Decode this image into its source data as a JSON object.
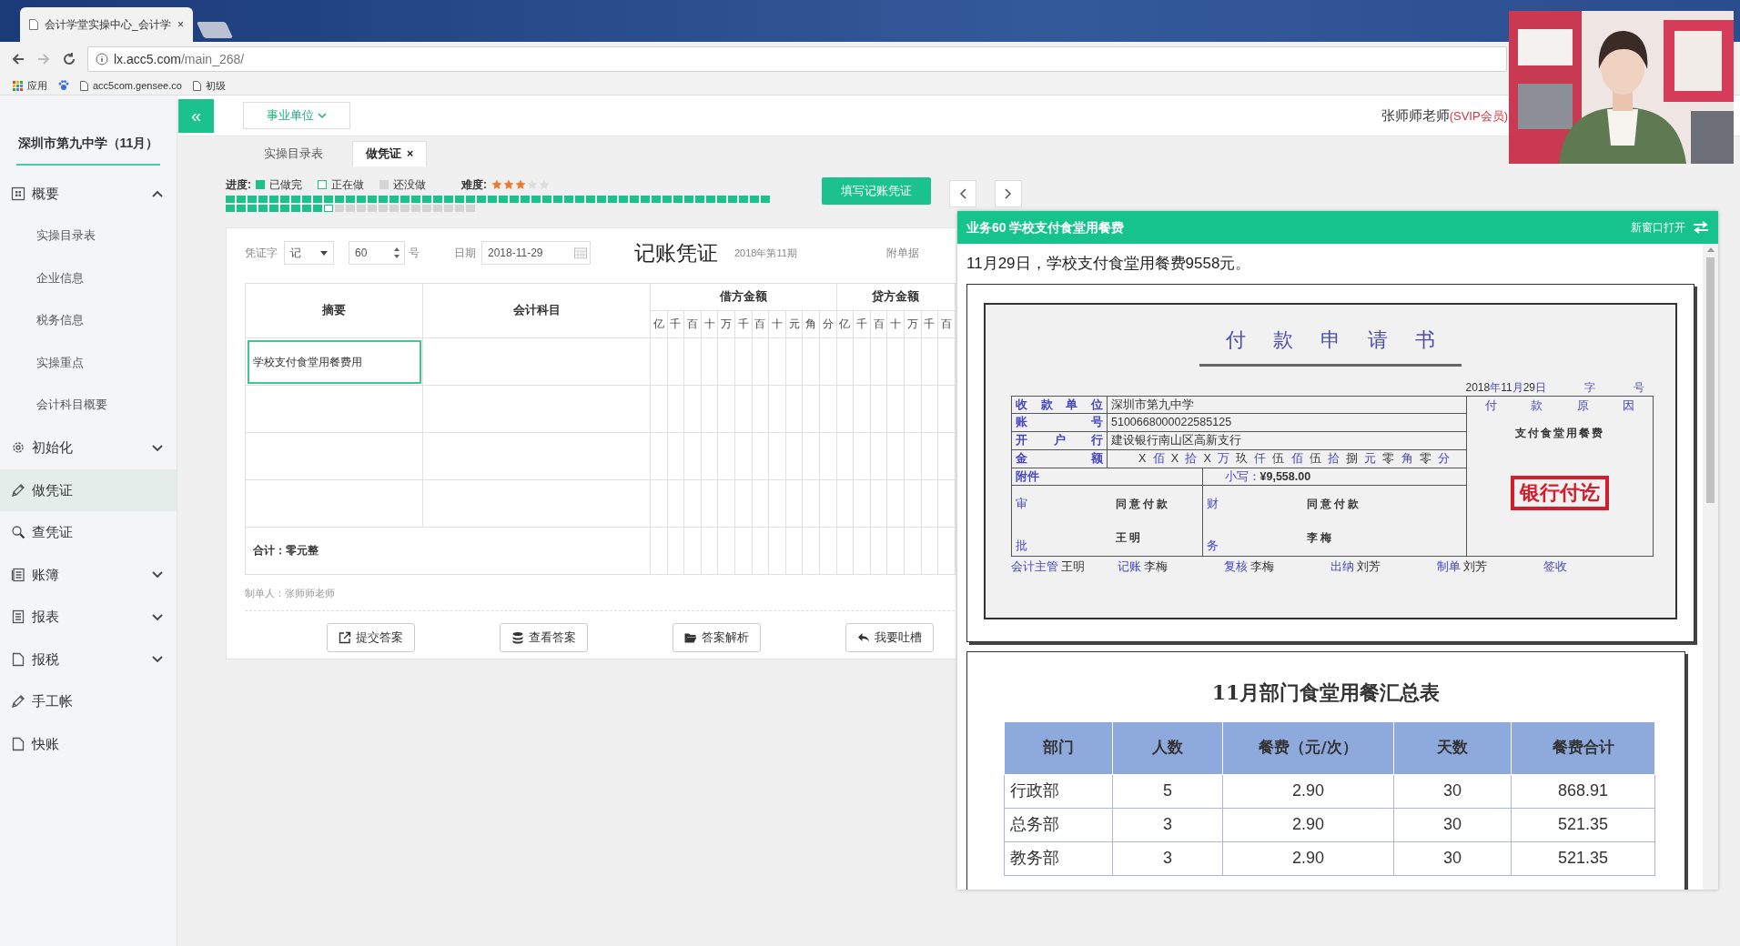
{
  "browser": {
    "tab_title": "会计学堂实操中心_会计学",
    "tab_close": "×",
    "url_host": "lx.acc5.com",
    "url_path": "/main_268/",
    "bookmarks": [
      {
        "kind": "apps",
        "label": "应用"
      },
      {
        "kind": "site"
      },
      {
        "kind": "page",
        "label": "acc5com.gensee.co"
      },
      {
        "kind": "page",
        "label": "初级"
      }
    ]
  },
  "sidebar": {
    "title": "深圳市第九中学（11月）",
    "items": [
      {
        "label": "概要",
        "expanded": true,
        "selected": false,
        "children": [
          {
            "label": "实操目录表",
            "selected": false
          },
          {
            "label": "企业信息",
            "selected": false
          },
          {
            "label": "税务信息",
            "selected": false
          },
          {
            "label": "实操重点",
            "selected": false
          },
          {
            "label": "会计科目概要",
            "selected": false
          }
        ]
      },
      {
        "label": "初始化",
        "expanded": false,
        "selected": false
      },
      {
        "label": "做凭证",
        "selected": true
      },
      {
        "label": "查凭证",
        "selected": false
      },
      {
        "label": "账簿",
        "expanded": false,
        "selected": false
      },
      {
        "label": "报表",
        "expanded": false,
        "selected": false
      },
      {
        "label": "报税",
        "expanded": false,
        "selected": false
      },
      {
        "label": "手工帐",
        "selected": false
      },
      {
        "label": "快账",
        "selected": false
      }
    ]
  },
  "header": {
    "collapse_button": "«",
    "unit_dropdown": "事业单位",
    "user_name": "张师师老师",
    "user_level": "(SVIP会员)"
  },
  "tabs": [
    {
      "label": "实操目录表",
      "selected": false
    },
    {
      "label": "做凭证",
      "selected": true,
      "close": "×"
    }
  ],
  "progress": {
    "label": "进度:",
    "legend": [
      {
        "kind": "done",
        "label": "已做完"
      },
      {
        "kind": "current",
        "label": "正在做"
      },
      {
        "kind": "todo",
        "label": "还没做"
      }
    ],
    "cells": [
      {
        "kind": "done"
      },
      {
        "kind": "done"
      },
      {
        "kind": "done"
      },
      {
        "kind": "done"
      },
      {
        "kind": "done"
      },
      {
        "kind": "done"
      },
      {
        "kind": "done"
      },
      {
        "kind": "done"
      },
      {
        "kind": "done"
      },
      {
        "kind": "done"
      },
      {
        "kind": "done"
      },
      {
        "kind": "done"
      },
      {
        "kind": "done"
      },
      {
        "kind": "done"
      },
      {
        "kind": "done"
      },
      {
        "kind": "done"
      },
      {
        "kind": "done"
      },
      {
        "kind": "done"
      },
      {
        "kind": "done"
      },
      {
        "kind": "done"
      },
      {
        "kind": "done"
      },
      {
        "kind": "done"
      },
      {
        "kind": "done"
      },
      {
        "kind": "done"
      },
      {
        "kind": "done"
      },
      {
        "kind": "done"
      },
      {
        "kind": "done"
      },
      {
        "kind": "done"
      },
      {
        "kind": "done"
      },
      {
        "kind": "done"
      },
      {
        "kind": "done"
      },
      {
        "kind": "done"
      },
      {
        "kind": "done"
      },
      {
        "kind": "done"
      },
      {
        "kind": "done"
      },
      {
        "kind": "done"
      },
      {
        "kind": "done"
      },
      {
        "kind": "done"
      },
      {
        "kind": "done"
      },
      {
        "kind": "done"
      },
      {
        "kind": "done"
      },
      {
        "kind": "done"
      },
      {
        "kind": "done"
      },
      {
        "kind": "done"
      },
      {
        "kind": "done"
      },
      {
        "kind": "done"
      },
      {
        "kind": "done"
      },
      {
        "kind": "done"
      },
      {
        "kind": "done"
      },
      {
        "kind": "done"
      },
      {
        "kind": "done"
      },
      {
        "kind": "done"
      },
      {
        "kind": "done"
      },
      {
        "kind": "done"
      },
      {
        "kind": "done"
      },
      {
        "kind": "done"
      },
      {
        "kind": "done"
      },
      {
        "kind": "done"
      },
      {
        "kind": "done"
      },
      {
        "kind": "current"
      },
      {
        "kind": "todo"
      },
      {
        "kind": "todo"
      },
      {
        "kind": "todo"
      },
      {
        "kind": "todo"
      },
      {
        "kind": "todo"
      },
      {
        "kind": "todo"
      },
      {
        "kind": "todo"
      },
      {
        "kind": "todo"
      },
      {
        "kind": "todo"
      },
      {
        "kind": "todo"
      },
      {
        "kind": "todo"
      },
      {
        "kind": "todo"
      },
      {
        "kind": "todo"
      }
    ]
  },
  "difficulty": {
    "label": "难度:",
    "stars": 3
  },
  "fill_voucher_button": "填写记账凭证",
  "voucher": {
    "word_label": "凭证字",
    "word": "记",
    "number": "60",
    "number_suffix": "号",
    "date_label": "日期",
    "date": "2018-11-29",
    "title": "记账凭证",
    "period": "2018年第11期",
    "attachments_label": "附单据",
    "columns": {
      "summary": "摘要",
      "account": "会计科目",
      "debit": "借方金额",
      "credit": "贷方金额"
    },
    "debit_digits": [
      "亿",
      "千",
      "百",
      "十",
      "万",
      "千",
      "百",
      "十",
      "元",
      "角",
      "分"
    ],
    "credit_digits": [
      "亿",
      "千",
      "百",
      "十",
      "万",
      "千",
      "百"
    ],
    "rows": [
      {
        "summary": "学校支付食堂用餐费用",
        "focused": true
      },
      {
        "focused": false
      },
      {
        "focused": false
      },
      {
        "focused": false
      }
    ],
    "total": "合计：零元整",
    "maker": "制单人：张师师老师",
    "buttons": [
      "提交答案",
      "查看答案",
      "答案解析",
      "我要吐槽"
    ]
  },
  "task_panel": {
    "title": "业务60 学校支付食堂用餐费",
    "open_new_window": "新窗口打开",
    "description": "11月29日，学校支付食堂用餐费9558元。",
    "documents": [
      {
        "kind": "payment_request",
        "title": "付款申请书",
        "date_parts": [
          "2018",
          "年",
          "11",
          "月",
          "29",
          "日"
        ],
        "word_label": "字",
        "number_label": "号",
        "fields": [
          {
            "label": "收款单位",
            "value": "深圳市第九中学"
          },
          {
            "label": "账号",
            "value": "5100668000022585125"
          },
          {
            "label": "开户行",
            "value": "建设银行南山区高新支行"
          }
        ],
        "amount_label": "金额",
        "amount_words": [
          "X",
          "佰",
          "X",
          "拾",
          "X",
          "万",
          "玖",
          "仟",
          "伍",
          "佰",
          "伍",
          "拾",
          "捌",
          "元",
          "零",
          "角",
          "零",
          "分"
        ],
        "attachment_label": "附件",
        "figure_label": "小写：",
        "figure": "¥9,558.00",
        "reason_label": "付款原因",
        "reason": "支付食堂用餐费",
        "stamp": "银行付讫",
        "approvals": [
          {
            "top_label": "审",
            "bottom_label": "批",
            "opinion": "同意付款",
            "signer": "王明"
          },
          {
            "top_label": "财",
            "bottom_label": "务",
            "opinion": "同意付款",
            "signer": "李梅"
          }
        ],
        "signatures": [
          {
            "role": "会计主管",
            "name": "王明"
          },
          {
            "role": "记账",
            "name": "李梅"
          },
          {
            "role": "复核",
            "name": "李梅"
          },
          {
            "role": "出纳",
            "name": "刘芳"
          },
          {
            "role": "制单",
            "name": "刘芳"
          },
          {
            "role": "签收"
          }
        ]
      },
      {
        "kind": "summary_table",
        "title": "11月部门食堂用餐汇总表",
        "columns": [
          "部门",
          "人数",
          "餐费（元/次）",
          "天数",
          "餐费合计"
        ],
        "rows": [
          [
            "行政部",
            "5",
            "2.90",
            "30",
            "868.91"
          ],
          [
            "总务部",
            "3",
            "2.90",
            "30",
            "521.35"
          ],
          [
            "教务部",
            "3",
            "2.90",
            "30",
            "521.35"
          ]
        ]
      }
    ]
  }
}
